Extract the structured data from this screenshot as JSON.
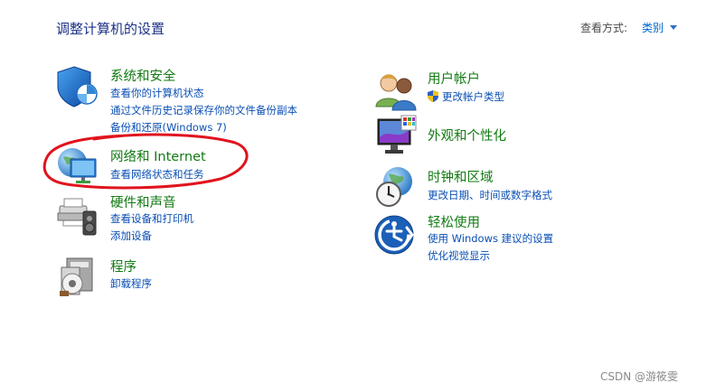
{
  "header": {
    "title": "调整计算机的设置",
    "view_by_label": "查看方式:",
    "view_by_value": "类别"
  },
  "left_categories": [
    {
      "title": "系统和安全",
      "icon": "security-shield-icon",
      "links": [
        "查看你的计算机状态",
        "通过文件历史记录保存你的文件备份副本",
        "备份和还原(Windows 7)"
      ]
    },
    {
      "title": "网络和 Internet",
      "icon": "network-globe-icon",
      "links": [
        "查看网络状态和任务"
      ]
    },
    {
      "title": "硬件和声音",
      "icon": "printer-speaker-icon",
      "links": [
        "查看设备和打印机",
        "添加设备"
      ]
    },
    {
      "title": "程序",
      "icon": "programs-disk-icon",
      "links": [
        "卸载程序"
      ]
    }
  ],
  "right_categories": [
    {
      "title": "用户帐户",
      "icon": "users-icon",
      "links": [
        "更改帐户类型"
      ]
    },
    {
      "title": "外观和个性化",
      "icon": "monitor-palette-icon",
      "links": []
    },
    {
      "title": "时钟和区域",
      "icon": "clock-globe-icon",
      "links": [
        "更改日期、时间或数字格式"
      ]
    },
    {
      "title": "轻松使用",
      "icon": "ease-of-access-icon",
      "links": [
        "使用 Windows 建议的设置",
        "优化视觉显示"
      ]
    }
  ],
  "watermark": "CSDN @游筱雯",
  "colors": {
    "title": "#1e3287",
    "category_title": "#127a12",
    "link": "#0a4fb4",
    "annotation": "#e0141e"
  }
}
